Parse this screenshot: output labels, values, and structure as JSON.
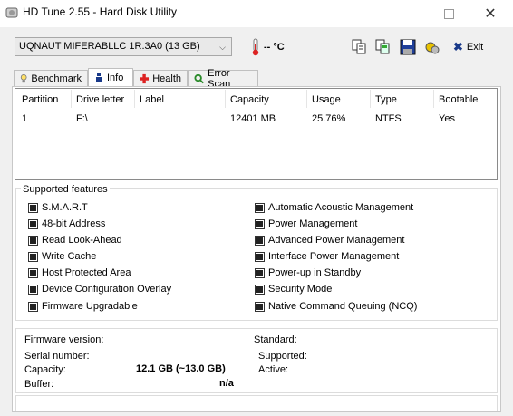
{
  "window": {
    "title": "HD Tune 2.55 - Hard Disk Utility"
  },
  "toolbar": {
    "drive": "UQNAUT MIFERABLLC 1R.3A0 (13 GB)",
    "temperature": "-- °C",
    "exit_label": "Exit"
  },
  "tabs": [
    {
      "label": "Benchmark"
    },
    {
      "label": "Info"
    },
    {
      "label": "Health"
    },
    {
      "label": "Error Scan"
    }
  ],
  "partitions": {
    "headers": [
      "Partition",
      "Drive letter",
      "Label",
      "Capacity",
      "Usage",
      "Type",
      "Bootable"
    ],
    "rows": [
      [
        "1",
        "F:\\",
        "",
        "12401 MB",
        "25.76%",
        "NTFS",
        "Yes"
      ]
    ]
  },
  "features": {
    "title": "Supported features",
    "left": [
      "S.M.A.R.T",
      "48-bit Address",
      "Read Look-Ahead",
      "Write Cache",
      "Host Protected Area",
      "Device Configuration Overlay",
      "Firmware Upgradable"
    ],
    "right": [
      "Automatic Acoustic Management",
      "Power Management",
      "Advanced Power Management",
      "Interface Power Management",
      "Power-up in Standby",
      "Security Mode",
      "Native Command Queuing (NCQ)"
    ]
  },
  "info": {
    "firmware_label": "Firmware version:",
    "serial_label": "Serial number:",
    "capacity_label": "Capacity:",
    "capacity_value": "12.1 GB (~13.0 GB)",
    "buffer_label": "Buffer:",
    "buffer_value": "n/a",
    "standard_label": "Standard:",
    "supported_label": "Supported:",
    "active_label": "Active:"
  }
}
